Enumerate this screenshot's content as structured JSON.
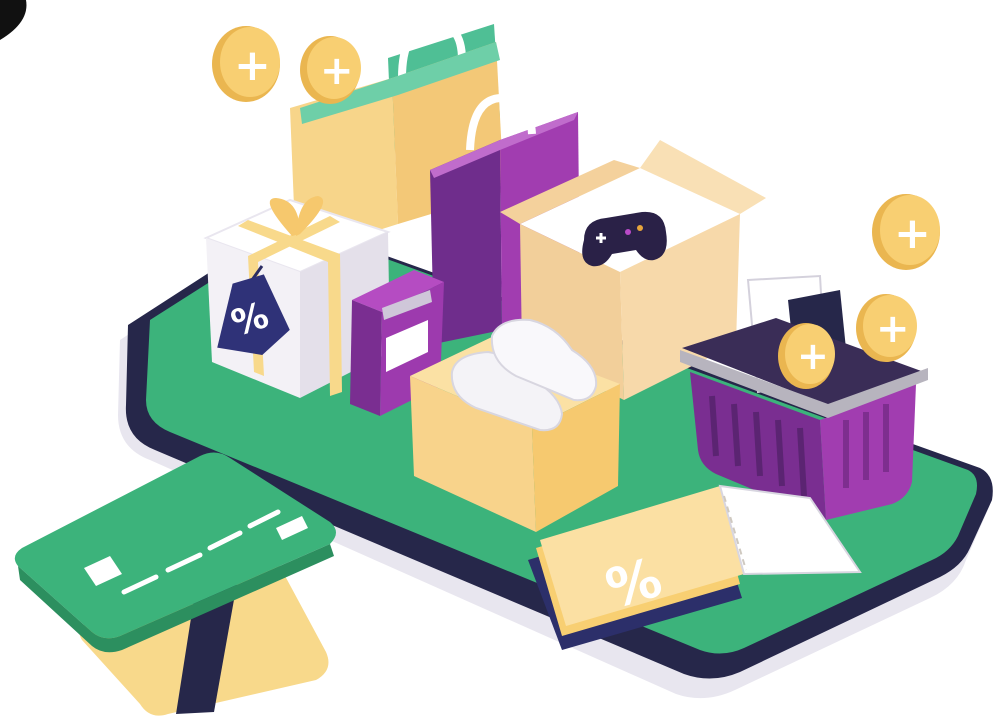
{
  "illustration": {
    "coins": [
      {
        "symbol": "+"
      },
      {
        "symbol": "+"
      },
      {
        "symbol": "+"
      },
      {
        "symbol": "+"
      },
      {
        "symbol": "+"
      }
    ],
    "price_tag": {
      "symbol": "%"
    },
    "coupon": {
      "symbol": "%"
    }
  },
  "palette": {
    "green": "#3cb37b",
    "purple": "#8c2f9b",
    "cream": "#f8d98b",
    "navy": "#24233f",
    "coin": "#f8cf72"
  }
}
